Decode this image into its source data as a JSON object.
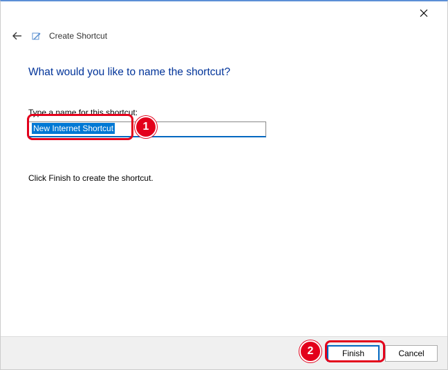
{
  "titlebar": {
    "close_label": "Close"
  },
  "header": {
    "wizard_title": "Create Shortcut"
  },
  "content": {
    "heading": "What would you like to name the shortcut?",
    "field_label": "Type a name for this shortcut:",
    "input_value": "New Internet Shortcut",
    "instruction": "Click Finish to create the shortcut."
  },
  "buttons": {
    "finish": "Finish",
    "cancel": "Cancel"
  },
  "annotations": {
    "badge1": "1",
    "badge2": "2"
  }
}
